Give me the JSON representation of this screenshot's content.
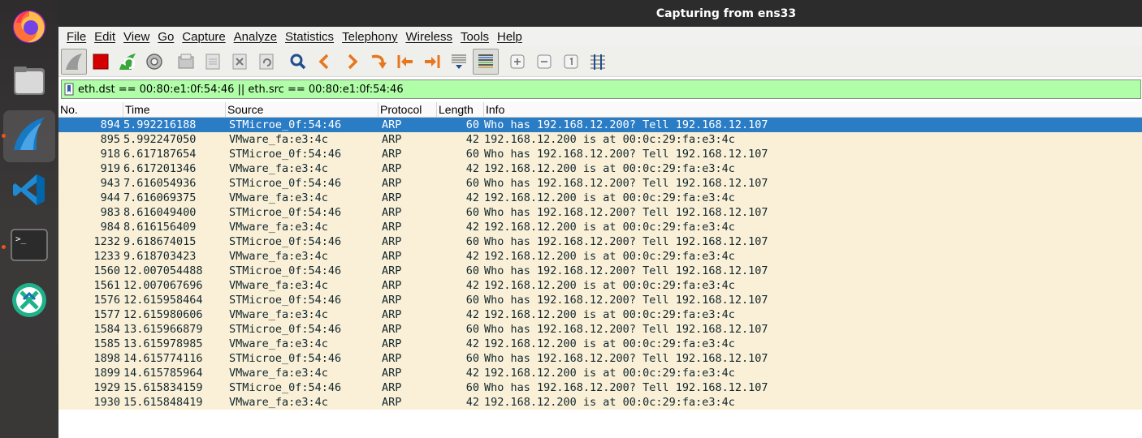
{
  "window": {
    "title": "Capturing from ens33"
  },
  "dock": {
    "items": [
      {
        "name": "firefox-icon"
      },
      {
        "name": "files-icon"
      },
      {
        "name": "wireshark-icon"
      },
      {
        "name": "vscode-icon"
      },
      {
        "name": "terminal-icon"
      },
      {
        "name": "remote-desktop-icon"
      }
    ]
  },
  "menu": {
    "file": "File",
    "edit": "Edit",
    "view": "View",
    "go": "Go",
    "capture": "Capture",
    "analyze": "Analyze",
    "statistics": "Statistics",
    "telephony": "Telephony",
    "wireless": "Wireless",
    "tools": "Tools",
    "help": "Help"
  },
  "filter": {
    "value": "eth.dst == 00:80:e1:0f:54:46 || eth.src == 00:80:e1:0f:54:46"
  },
  "columns": {
    "no": "No.",
    "time": "Time",
    "source": "Source",
    "protocol": "Protocol",
    "length": "Length",
    "info": "Info"
  },
  "packets": [
    {
      "no": "894",
      "time": "5.992216188",
      "source": "STMicroe_0f:54:46",
      "protocol": "ARP",
      "length": "60",
      "info": "Who has 192.168.12.200? Tell 192.168.12.107"
    },
    {
      "no": "895",
      "time": "5.992247050",
      "source": "VMware_fa:e3:4c",
      "protocol": "ARP",
      "length": "42",
      "info": "192.168.12.200 is at 00:0c:29:fa:e3:4c"
    },
    {
      "no": "918",
      "time": "6.617187654",
      "source": "STMicroe_0f:54:46",
      "protocol": "ARP",
      "length": "60",
      "info": "Who has 192.168.12.200? Tell 192.168.12.107"
    },
    {
      "no": "919",
      "time": "6.617201346",
      "source": "VMware_fa:e3:4c",
      "protocol": "ARP",
      "length": "42",
      "info": "192.168.12.200 is at 00:0c:29:fa:e3:4c"
    },
    {
      "no": "943",
      "time": "7.616054936",
      "source": "STMicroe_0f:54:46",
      "protocol": "ARP",
      "length": "60",
      "info": "Who has 192.168.12.200? Tell 192.168.12.107"
    },
    {
      "no": "944",
      "time": "7.616069375",
      "source": "VMware_fa:e3:4c",
      "protocol": "ARP",
      "length": "42",
      "info": "192.168.12.200 is at 00:0c:29:fa:e3:4c"
    },
    {
      "no": "983",
      "time": "8.616049400",
      "source": "STMicroe_0f:54:46",
      "protocol": "ARP",
      "length": "60",
      "info": "Who has 192.168.12.200? Tell 192.168.12.107"
    },
    {
      "no": "984",
      "time": "8.616156409",
      "source": "VMware_fa:e3:4c",
      "protocol": "ARP",
      "length": "42",
      "info": "192.168.12.200 is at 00:0c:29:fa:e3:4c"
    },
    {
      "no": "1232",
      "time": "9.618674015",
      "source": "STMicroe_0f:54:46",
      "protocol": "ARP",
      "length": "60",
      "info": "Who has 192.168.12.200? Tell 192.168.12.107"
    },
    {
      "no": "1233",
      "time": "9.618703423",
      "source": "VMware_fa:e3:4c",
      "protocol": "ARP",
      "length": "42",
      "info": "192.168.12.200 is at 00:0c:29:fa:e3:4c"
    },
    {
      "no": "1560",
      "time": "12.007054488",
      "source": "STMicroe_0f:54:46",
      "protocol": "ARP",
      "length": "60",
      "info": "Who has 192.168.12.200? Tell 192.168.12.107"
    },
    {
      "no": "1561",
      "time": "12.007067696",
      "source": "VMware_fa:e3:4c",
      "protocol": "ARP",
      "length": "42",
      "info": "192.168.12.200 is at 00:0c:29:fa:e3:4c"
    },
    {
      "no": "1576",
      "time": "12.615958464",
      "source": "STMicroe_0f:54:46",
      "protocol": "ARP",
      "length": "60",
      "info": "Who has 192.168.12.200? Tell 192.168.12.107"
    },
    {
      "no": "1577",
      "time": "12.615980606",
      "source": "VMware_fa:e3:4c",
      "protocol": "ARP",
      "length": "42",
      "info": "192.168.12.200 is at 00:0c:29:fa:e3:4c"
    },
    {
      "no": "1584",
      "time": "13.615966879",
      "source": "STMicroe_0f:54:46",
      "protocol": "ARP",
      "length": "60",
      "info": "Who has 192.168.12.200? Tell 192.168.12.107"
    },
    {
      "no": "1585",
      "time": "13.615978985",
      "source": "VMware_fa:e3:4c",
      "protocol": "ARP",
      "length": "42",
      "info": "192.168.12.200 is at 00:0c:29:fa:e3:4c"
    },
    {
      "no": "1898",
      "time": "14.615774116",
      "source": "STMicroe_0f:54:46",
      "protocol": "ARP",
      "length": "60",
      "info": "Who has 192.168.12.200? Tell 192.168.12.107"
    },
    {
      "no": "1899",
      "time": "14.615785964",
      "source": "VMware_fa:e3:4c",
      "protocol": "ARP",
      "length": "42",
      "info": "192.168.12.200 is at 00:0c:29:fa:e3:4c"
    },
    {
      "no": "1929",
      "time": "15.615834159",
      "source": "STMicroe_0f:54:46",
      "protocol": "ARP",
      "length": "60",
      "info": "Who has 192.168.12.200? Tell 192.168.12.107"
    },
    {
      "no": "1930",
      "time": "15.615848419",
      "source": "VMware_fa:e3:4c",
      "protocol": "ARP",
      "length": "42",
      "info": "192.168.12.200 is at 00:0c:29:fa:e3:4c"
    }
  ],
  "selected_row": 0,
  "colors": {
    "row_bg": "#faf0d7",
    "selected_bg": "#2a7cc5",
    "filter_valid_bg": "#b0ffa8"
  }
}
